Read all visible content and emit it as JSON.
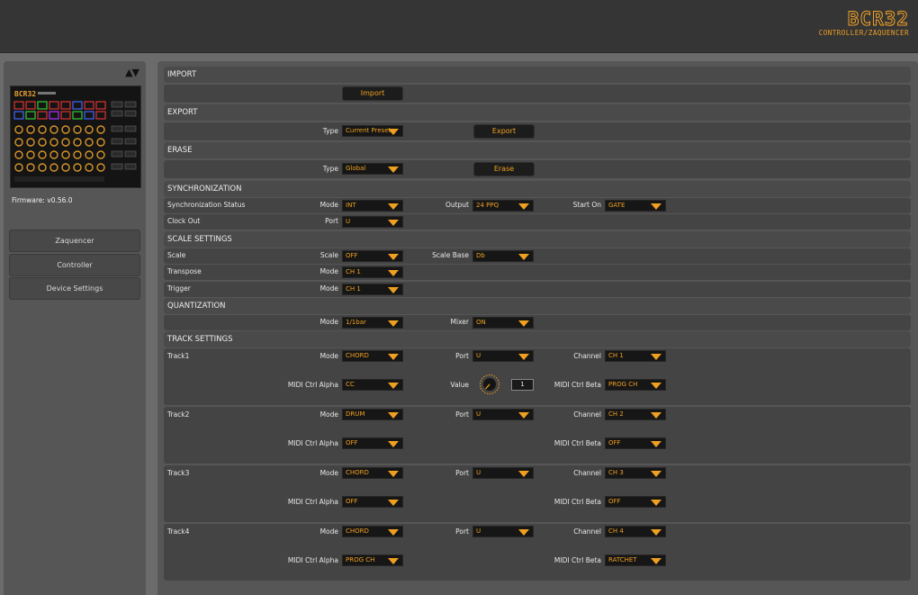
{
  "header": {
    "logo_main": "BCR32",
    "logo_sub": "CONTROLLER/ZAQUENCER"
  },
  "sidebar": {
    "arrow_up": "▲",
    "arrow_down": "▼",
    "device_logo": "BCR32",
    "firmware": "Firmware: v0.56.0",
    "items": [
      {
        "label": "Zaquencer"
      },
      {
        "label": "Controller"
      },
      {
        "label": "Device Settings"
      }
    ]
  },
  "import": {
    "title": "IMPORT",
    "button": "Import"
  },
  "export": {
    "title": "EXPORT",
    "type_label": "Type",
    "type_value": "Current Preset",
    "button": "Export"
  },
  "erase": {
    "title": "ERASE",
    "type_label": "Type",
    "type_value": "Global",
    "button": "Erase"
  },
  "sync": {
    "title": "SYNCHRONIZATION",
    "status_label": "Synchronization Status",
    "mode_label": "Mode",
    "mode_value": "INT",
    "output_label": "Output",
    "output_value": "24 PPQ",
    "start_label": "Start On",
    "start_value": "GATE",
    "clock_label": "Clock Out",
    "port_label": "Port",
    "port_value": "U"
  },
  "scale": {
    "title": "SCALE SETTINGS",
    "scale_row": "Scale",
    "scale_label": "Scale",
    "scale_value": "OFF",
    "base_label": "Scale Base",
    "base_value": "Db",
    "transpose_row": "Transpose",
    "transpose_mode_label": "Mode",
    "transpose_mode_value": "CH 1",
    "trigger_row": "Trigger",
    "trigger_mode_label": "Mode",
    "trigger_mode_value": "CH 1"
  },
  "quant": {
    "title": "QUANTIZATION",
    "mode_label": "Mode",
    "mode_value": "1/1bar",
    "mixer_label": "Mixer",
    "mixer_value": "ON"
  },
  "tracks": {
    "title": "TRACK SETTINGS",
    "mode_label": "Mode",
    "port_label": "Port",
    "channel_label": "Channel",
    "alpha_label": "MIDI Ctrl Alpha",
    "beta_label": "MIDI Ctrl Beta",
    "value_label": "Value",
    "items": [
      {
        "name": "Track1",
        "mode": "CHORD",
        "port": "U",
        "channel": "CH 1",
        "alpha": "CC",
        "beta": "PROG CH",
        "value": "1"
      },
      {
        "name": "Track2",
        "mode": "DRUM",
        "port": "U",
        "channel": "CH 2",
        "alpha": "OFF",
        "beta": "OFF"
      },
      {
        "name": "Track3",
        "mode": "CHORD",
        "port": "U",
        "channel": "CH 3",
        "alpha": "OFF",
        "beta": "OFF"
      },
      {
        "name": "Track4",
        "mode": "CHORD",
        "port": "U",
        "channel": "CH 4",
        "alpha": "PROG CH",
        "beta": "RATCHET"
      }
    ]
  },
  "colors": {
    "accent": "#f0a020",
    "panel": "#565656",
    "row": "#444444",
    "section": "#4a4a4a"
  }
}
